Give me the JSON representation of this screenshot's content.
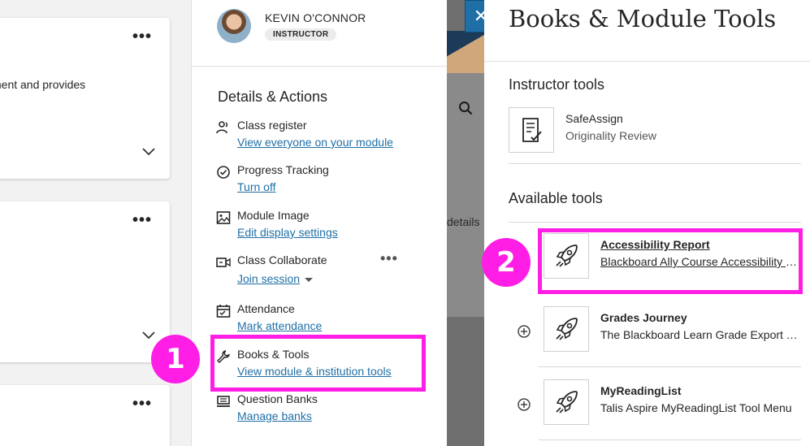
{
  "left_content": {
    "card1_text": "ment and provides",
    "more_glyph": "•••"
  },
  "profile": {
    "name": "KEVIN O'CONNOR",
    "role": "INSTRUCTOR"
  },
  "details": {
    "title": "Details & Actions",
    "actions": [
      {
        "label": "Class register",
        "link": "View everyone on your module",
        "icon": "users-icon"
      },
      {
        "label": "Progress Tracking",
        "link": "Turn off",
        "icon": "check-circle-icon"
      },
      {
        "label": "Module Image",
        "link": "Edit display settings",
        "icon": "image-icon"
      },
      {
        "label": "Class Collaborate",
        "link": "Join session",
        "icon": "video-icon"
      },
      {
        "label": "Attendance",
        "link": "Mark attendance",
        "icon": "calendar-icon"
      },
      {
        "label": "Books & Tools",
        "link": "View module & institution tools",
        "icon": "wrench-icon"
      },
      {
        "label": "Question Banks",
        "link": "Manage banks",
        "icon": "bank-icon"
      }
    ]
  },
  "overlay": {
    "details_fragment": "details",
    "close_glyph": "✕"
  },
  "tools_panel": {
    "title": "Books & Module Tools",
    "instructor_section": "Instructor tools",
    "available_section": "Available tools",
    "instructor_tools": [
      {
        "name": "SafeAssign",
        "desc": "Originality Review",
        "icon": "document-check-icon"
      }
    ],
    "available_tools": [
      {
        "name": "Accessibility Report",
        "desc": "Blackboard Ally Course Accessibility Report",
        "icon": "rocket-icon"
      },
      {
        "name": "Grades Journey",
        "desc": "The Blackboard Learn Grade Export Tool",
        "icon": "rocket-icon"
      },
      {
        "name": "MyReadingList",
        "desc": "Talis Aspire MyReadingList Tool Menu",
        "icon": "rocket-icon"
      }
    ]
  },
  "annotations": {
    "step1": "1",
    "step2": "2",
    "highlight_color": "#ff1ee6"
  },
  "colors": {
    "link": "#1f6fa6",
    "close_button": "#1f6fa6"
  }
}
